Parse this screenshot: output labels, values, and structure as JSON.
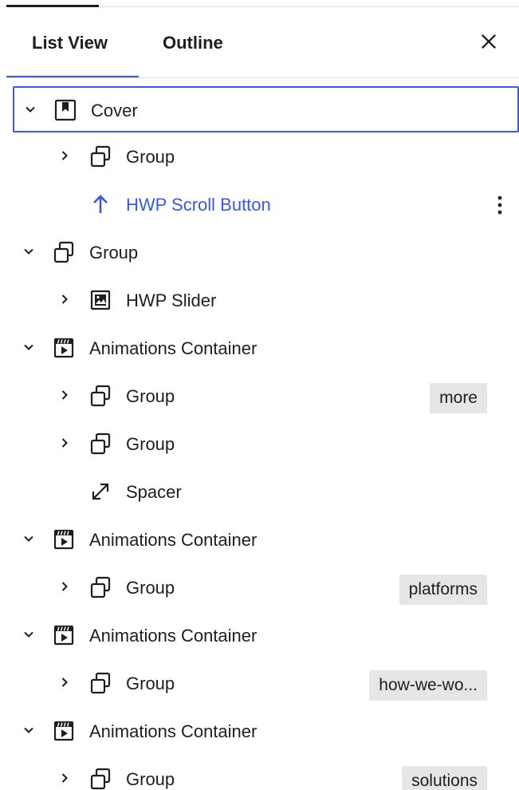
{
  "tabs": {
    "list_view": "List View",
    "outline": "Outline"
  },
  "blocks": [
    {
      "label": "Cover",
      "icon": "cover-icon",
      "expanded": true,
      "selected": true
    },
    {
      "label": "Group",
      "icon": "group-icon",
      "expanded": false
    },
    {
      "label": "HWP Scroll Button",
      "icon": "arrow-up-icon",
      "expanded": null,
      "link": true
    },
    {
      "label": "Group",
      "icon": "group-icon",
      "expanded": true
    },
    {
      "label": "HWP Slider",
      "icon": "slider-icon",
      "expanded": false
    },
    {
      "label": "Animations Container",
      "icon": "animation-icon",
      "expanded": true
    },
    {
      "label": "Group",
      "icon": "group-icon",
      "expanded": false,
      "anchor": "more"
    },
    {
      "label": "Group",
      "icon": "group-icon",
      "expanded": false
    },
    {
      "label": "Spacer",
      "icon": "spacer-icon",
      "expanded": null
    },
    {
      "label": "Animations Container",
      "icon": "animation-icon",
      "expanded": true
    },
    {
      "label": "Group",
      "icon": "group-icon",
      "expanded": false,
      "anchor": "platforms"
    },
    {
      "label": "Animations Container",
      "icon": "animation-icon",
      "expanded": true
    },
    {
      "label": "Group",
      "icon": "group-icon",
      "expanded": false,
      "anchor": "how-we-wo..."
    },
    {
      "label": "Animations Container",
      "icon": "animation-icon",
      "expanded": true
    },
    {
      "label": "Group",
      "icon": "group-icon",
      "expanded": false,
      "anchor": "solutions"
    }
  ],
  "colors": {
    "accent": "#3858e9",
    "badge_bg": "#e6e6e6",
    "text": "#1e1e1e"
  }
}
